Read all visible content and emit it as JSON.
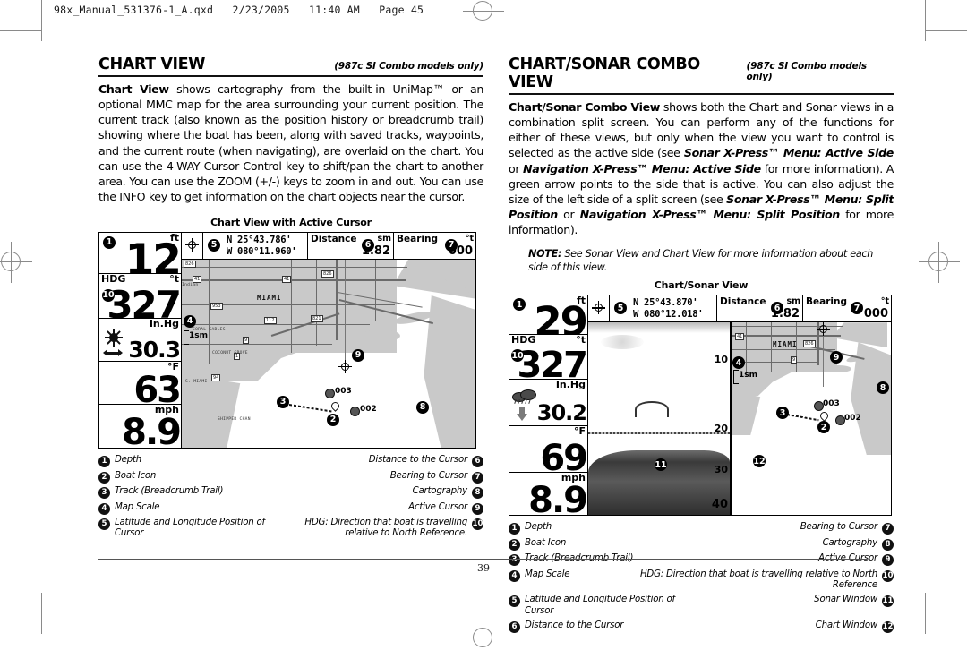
{
  "file_header": "98x_Manual_531376-1_A.qxd   2/23/2005   11:40 AM   Page 45",
  "page_number": "39",
  "left_column": {
    "heading": "CHART VIEW",
    "models_note": "(987c SI Combo models only)",
    "paragraph_lead": "Chart View",
    "paragraph_rest": " shows cartography from the built-in UniMap™ or an optional MMC map for the area surrounding your current position. The current track (also known as the position history or breadcrumb trail) showing where the boat has been, along with saved tracks, waypoints, and the current route (when navigating), are overlaid on the chart. You can use the 4-WAY Cursor Control key to shift/pan the chart to another area. You can use the ZOOM (+/-) keys to zoom in and out. You can use the INFO key to get information on the chart objects near the cursor.",
    "figure_caption": "Chart View with Active Cursor",
    "figure": {
      "depth_unit": "ft",
      "depth_value": "12",
      "hdg_label": "HDG",
      "hdg_unit": "°t",
      "hdg_value": "327",
      "pressure_unit": "In.Hg",
      "pressure_value": "30.3",
      "temp_unit": "°F",
      "temp_value": "63",
      "speed_unit": "mph",
      "speed_value": "8.9",
      "lat": "N 25°43.786'",
      "lon": "W 080°11.960'",
      "distance_label": "Distance",
      "distance_unit": "sm",
      "distance_value": "1.82",
      "bearing_label": "Bearing",
      "bearing_unit": "°t",
      "bearing_value": "000",
      "map_scale": "1sm",
      "place_name": "MIAMI",
      "waypoint_a": "003",
      "waypoint_b": "002",
      "minor_places": [
        "CORAL GABLES",
        "COCONUT GROVE",
        "S. MIAMI",
        "SHIPPER CHAN",
        "Indian"
      ],
      "route_shields": [
        "41",
        "953",
        "1",
        "9",
        "112",
        "821",
        "826",
        "94"
      ]
    },
    "legend_left": [
      {
        "num": "1",
        "label": "Depth"
      },
      {
        "num": "2",
        "label": "Boat Icon"
      },
      {
        "num": "3",
        "label": "Track (Breadcrumb Trail)"
      },
      {
        "num": "4",
        "label": "Map Scale"
      },
      {
        "num": "5",
        "label": "Latitude and Longitude Position of Cursor"
      }
    ],
    "legend_right": [
      {
        "num": "6",
        "label": "Distance to the Cursor"
      },
      {
        "num": "7",
        "label": "Bearing to Cursor"
      },
      {
        "num": "8",
        "label": "Cartography"
      },
      {
        "num": "9",
        "label": "Active Cursor"
      },
      {
        "num": "10",
        "label": "HDG: Direction that boat is travelling relative to North Reference."
      }
    ]
  },
  "right_column": {
    "heading": "CHART/SONAR COMBO VIEW",
    "models_note": "(987c SI Combo models only)",
    "paragraph_lead": "Chart/Sonar Combo View",
    "paragraph_parts": [
      {
        "t": " shows both the Chart and Sonar views in a combination split screen. You can perform any of the functions for either of these views, but only when the view you want to control is selected as the active side (see ",
        "s": "n"
      },
      {
        "t": "Sonar X-Press™ Menu: Active Side",
        "s": "bi"
      },
      {
        "t": " or ",
        "s": "n"
      },
      {
        "t": "Navigation X-Press™ Menu: Active Side",
        "s": "bi"
      },
      {
        "t": " for more information). A green arrow points to the side that is active. You can also adjust the size of the left side of a split screen (see ",
        "s": "n"
      },
      {
        "t": "Sonar X-Press™ Menu: Split Position",
        "s": "bi"
      },
      {
        "t": " or ",
        "s": "n"
      },
      {
        "t": "Navigation X-Press™ Menu: Split Position",
        "s": "bi"
      },
      {
        "t": " for more information).",
        "s": "n"
      }
    ],
    "note_bold": "NOTE:",
    "note_text": " See Sonar View and Chart View for more information about each side of this view.",
    "figure_caption": "Chart/Sonar View",
    "figure": {
      "depth_unit": "ft",
      "depth_value": "29",
      "hdg_label": "HDG",
      "hdg_unit": "°t",
      "hdg_value": "327",
      "pressure_unit": "In.Hg",
      "pressure_value": "30.2",
      "temp_unit": "°F",
      "temp_value": "69",
      "speed_unit": "mph",
      "speed_value": "8.9",
      "lat": "N 25°43.870'",
      "lon": "W 080°12.018'",
      "distance_label": "Distance",
      "distance_unit": "sm",
      "distance_value": "1.82",
      "bearing_label": "Bearing",
      "bearing_unit": "°t",
      "bearing_value": "000",
      "map_scale": "1sm",
      "place_name": "MIAMI",
      "waypoint_a": "003",
      "waypoint_b": "002",
      "depth_ticks": [
        "10",
        "20",
        "30",
        "40"
      ]
    },
    "legend_left": [
      {
        "num": "1",
        "label": "Depth"
      },
      {
        "num": "2",
        "label": "Boat Icon"
      },
      {
        "num": "3",
        "label": "Track (Breadcrumb Trail)"
      },
      {
        "num": "4",
        "label": "Map Scale"
      },
      {
        "num": "5",
        "label": "Latitude and Longitude Position of Cursor"
      },
      {
        "num": "6",
        "label": "Distance to the Cursor"
      }
    ],
    "legend_right": [
      {
        "num": "7",
        "label": "Bearing to Cursor"
      },
      {
        "num": "8",
        "label": "Cartography"
      },
      {
        "num": "9",
        "label": "Active Cursor"
      },
      {
        "num": "10",
        "label": "HDG: Direction that boat is travelling relative to North Reference"
      },
      {
        "num": "11",
        "label": "Sonar Window"
      },
      {
        "num": "12",
        "label": "Chart Window"
      }
    ]
  }
}
